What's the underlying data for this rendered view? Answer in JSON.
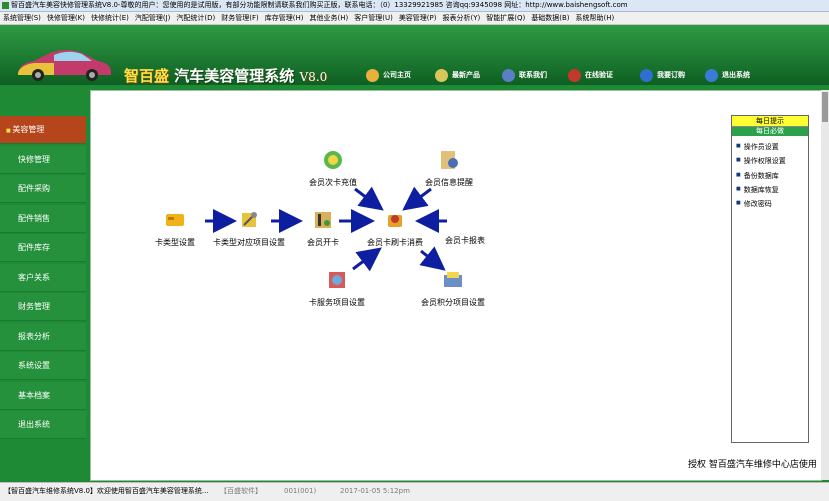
{
  "window": {
    "title": "智百盛汽车美容快修管理系统V8.0-尊敬的用户：您使用的是试用版，有部分功能限制请联系我们购买正版，联系电话：（0）13329921985  咨询qq:9345098   网址：http://www.baishengsoft.com"
  },
  "menu": [
    "系统管理(S)",
    "快修管理(K)",
    "快修统计(E)",
    "汽配管理(J)",
    "汽配统计(D)",
    "财务管理(F)",
    "库存管理(H)",
    "其他业务(H)",
    "客户管理(U)",
    "美容管理(P)",
    "报表分析(Y)",
    "智能扩展(Q)",
    "基础数据(B)",
    "系统帮助(H)"
  ],
  "brand": {
    "name": "智百盛",
    "product": "汽车美容管理系统",
    "version": "V8.0"
  },
  "toplinks": [
    {
      "label": "公司主页",
      "icon": "globe-icon",
      "color": "#e8b23a"
    },
    {
      "label": "最新产品",
      "icon": "disc-icon",
      "color": "#d9c55a"
    },
    {
      "label": "联系我们",
      "icon": "phone-icon",
      "color": "#5b7fc7"
    },
    {
      "label": "在线验证",
      "icon": "shield-icon",
      "color": "#c0392b"
    },
    {
      "label": "我要订购",
      "icon": "cart-icon",
      "color": "#2f6fd0"
    },
    {
      "label": "退出系统",
      "icon": "exit-icon",
      "color": "#3a7bd5"
    }
  ],
  "sidebar": [
    "美容管理",
    "快修管理",
    "配件采购",
    "配件销售",
    "配件库存",
    "客户关系",
    "财务管理",
    "报表分析",
    "系统设置",
    "基本档案",
    "退出系统"
  ],
  "active_nav": "美容管理",
  "workflow": {
    "card_type": "卡类型设置",
    "card_type_items": "卡类型对应项目设置",
    "open_card": "会员开卡",
    "recharge": "会员次卡充值",
    "reminder": "会员信息提醒",
    "consume": "会员卡刷卡消费",
    "report": "会员卡报表",
    "service_items": "卡服务项目设置",
    "points_items": "会员积分项目设置"
  },
  "tips": {
    "title": "每日提示",
    "subtitle": "每日必做",
    "items": [
      "操作员设置",
      "操作权限设置",
      "备份数据库",
      "数据库恢复",
      "修改密码"
    ]
  },
  "license": "授权  智百盛汽车维修中心店使用",
  "statusbar": {
    "app": "【智百盛汽车维修系统V8.0】欢迎使用智百盛汽车美容管理系统...",
    "company": "【百盛软件】",
    "operator": "001(001)",
    "datetime": "2017-01-05 5:12pm"
  }
}
